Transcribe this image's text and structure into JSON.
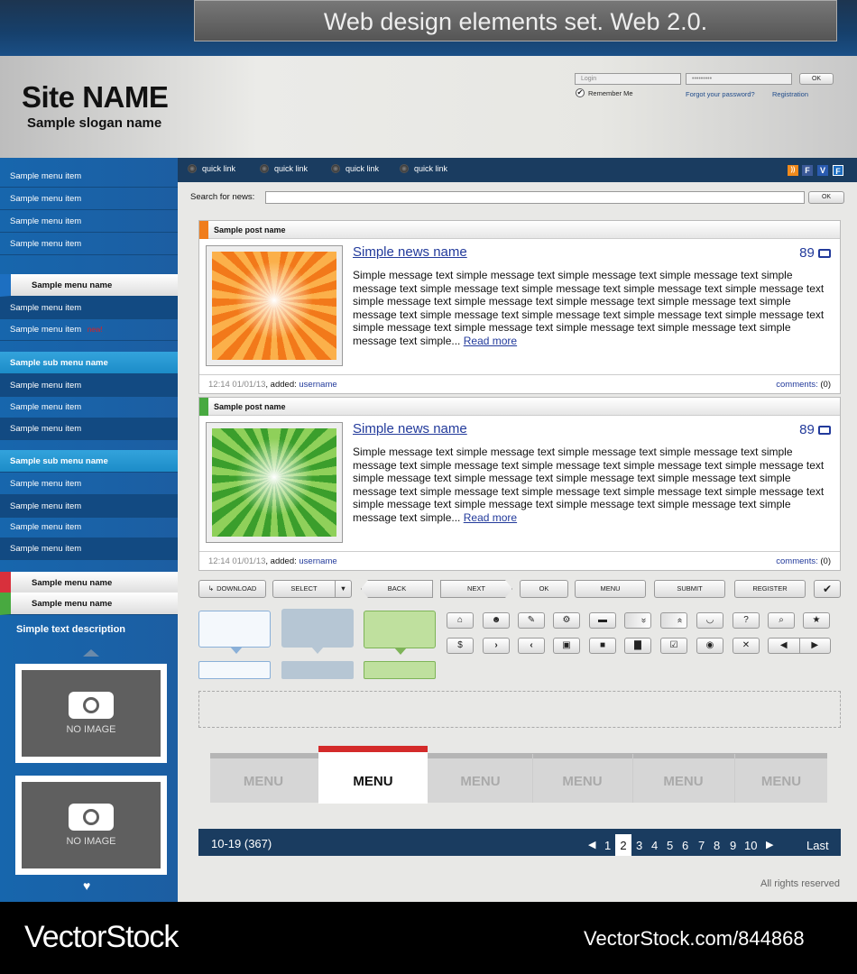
{
  "banner": {
    "title": "Web design elements set. Web 2.0."
  },
  "site": {
    "name": "Site NAME",
    "slogan": "Sample slogan name"
  },
  "login": {
    "login_placeholder": "Login",
    "password_placeholder": "•••••••••",
    "ok": "OK",
    "remember": "Remember Me",
    "forgot": "Forgot your password?",
    "registration": "Registration"
  },
  "quick_links": [
    "quick link",
    "quick link",
    "quick link",
    "quick link"
  ],
  "social": [
    "RSS",
    "F",
    "V",
    "F"
  ],
  "search": {
    "label": "Search for news:",
    "ok": "OK"
  },
  "sidebar": {
    "group1": [
      "Sample menu item",
      "Sample menu item",
      "Sample menu item",
      "Sample menu item"
    ],
    "menu_name": "Sample menu name",
    "group2": [
      "Sample menu item",
      "Sample menu item"
    ],
    "new_label": "new!",
    "sub1": "Sample sub menu name",
    "group3": [
      "Sample menu item",
      "Sample menu item",
      "Sample menu item"
    ],
    "sub2": "Sample sub menu name",
    "group4": [
      "Sample menu item",
      "Sample menu item",
      "Sample menu item",
      "Sample menu item"
    ],
    "menu_name2": "Sample menu name",
    "menu_name3": "Sample menu name",
    "description": "Simple text description",
    "no_image": "NO IMAGE"
  },
  "posts": [
    {
      "title": "Sample post name",
      "news": "Simple news name",
      "count": "89",
      "message": "Simple message text simple  message text simple message text simple message text simple message text simple message text simple message text simple message text simple message text simple message text simple message text simple message text simple message text simple message text simple message text simple message text simple message text simple  message text simple message text simple message text simple message text simple message text simple message text simple...",
      "read_more": "Read more",
      "time": "12:14  01/01/13",
      "added": ", added: ",
      "user": "username",
      "comments": "comments:",
      "comments_count": "(0)",
      "accent": "#f07d1c"
    },
    {
      "title": "Sample post name",
      "news": "Simple news name",
      "count": "89",
      "message": "Simple message text simple  message text simple message text simple message text simple message text simple message text simple message text simple message text simple message text simple message text simple message text simple message text simple message text simple message text simple message text simple message text simple message text simple  message text simple message text simple message text simple message text simple message text simple message text simple...",
      "read_more": "Read more",
      "time": "12:14  01/01/13",
      "added": ", added: ",
      "user": "username",
      "comments": "comments:",
      "comments_count": "(0)",
      "accent": "#48a940"
    }
  ],
  "buttons": {
    "download": "DOWNLOAD",
    "select": "SELECT",
    "back": "BACK",
    "next": "NEXT",
    "ok": "OK",
    "menu": "MENU",
    "submit": "SUBMIT",
    "register": "REGISTER"
  },
  "icons_row1": [
    "⌂",
    "☻",
    "✎",
    "⚙",
    "▬",
    "»",
    "«",
    "◡",
    "?",
    "⌕",
    "★"
  ],
  "icons_row2": [
    "$",
    "›",
    "‹",
    "▣",
    "■",
    "▇",
    "☑",
    "◉",
    "✕"
  ],
  "tabs": [
    "MENU",
    "MENU",
    "MENU",
    "MENU",
    "MENU",
    "MENU"
  ],
  "pagination": {
    "range": "10-19 (367)",
    "pages": [
      "1",
      "2",
      "3",
      "4",
      "5",
      "6",
      "7",
      "8",
      "9",
      "10"
    ],
    "current": "2",
    "last": "Last"
  },
  "footer": {
    "rights": "All rights reserved"
  },
  "watermark": {
    "left": "VectorStock",
    "right": "VectorStock.com/844868"
  }
}
